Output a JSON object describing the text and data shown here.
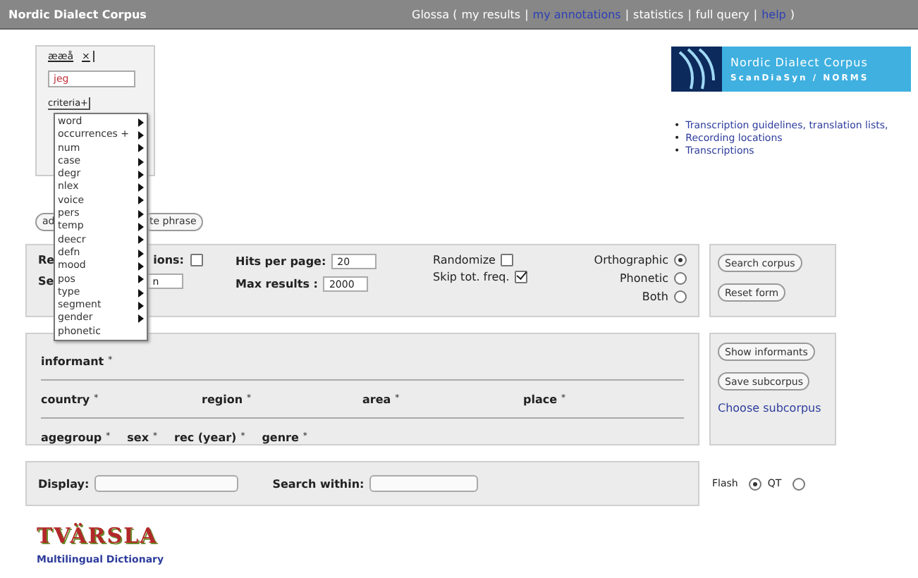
{
  "top_bar": {
    "title": "Nordic Dialect Corpus",
    "nav": [
      {
        "kind": "label",
        "text": "Glossa ("
      },
      {
        "kind": "link",
        "text": "my results",
        "highlighted": false
      },
      {
        "kind": "sep",
        "text": "|"
      },
      {
        "kind": "link",
        "text": "my annotations",
        "highlighted": true
      },
      {
        "kind": "sep",
        "text": "|"
      },
      {
        "kind": "link",
        "text": "statistics",
        "highlighted": false
      },
      {
        "kind": "sep",
        "text": "|"
      },
      {
        "kind": "link",
        "text": "full query",
        "highlighted": false
      },
      {
        "kind": "sep",
        "text": "|"
      },
      {
        "kind": "link",
        "text": "help",
        "highlighted": true
      },
      {
        "kind": "label",
        "text": ")"
      }
    ]
  },
  "token_box": {
    "header": "ææå",
    "close": "×",
    "value": "jeg",
    "criteria": "criteria+",
    "menu": [
      {
        "label": "word",
        "submenu": true
      },
      {
        "label": "occurrences +",
        "submenu": true
      },
      {
        "label": "num",
        "submenu": true
      },
      {
        "label": "case",
        "submenu": true
      },
      {
        "label": "degr",
        "submenu": true
      },
      {
        "label": "nlex",
        "submenu": true
      },
      {
        "label": "voice",
        "submenu": true
      },
      {
        "label": "pers",
        "submenu": true
      },
      {
        "label": "temp",
        "submenu": true
      },
      {
        "label": "deecr",
        "submenu": true
      },
      {
        "label": "defn",
        "submenu": true
      },
      {
        "label": "mood",
        "submenu": true
      },
      {
        "label": "pos",
        "submenu": true
      },
      {
        "label": "type",
        "submenu": true
      },
      {
        "label": "segment",
        "submenu": true
      },
      {
        "label": "gender",
        "submenu": true
      },
      {
        "label": "phonetic",
        "submenu": false
      }
    ]
  },
  "phrase_buttons": [
    "ad",
    "te phrase"
  ],
  "logo": {
    "title": "Nordic Dialect Corpus",
    "subtitle": "ScanDiaSyn / NORMS"
  },
  "links": [
    {
      "marker": "•",
      "text": "Transcription guidelines, translation lists,"
    },
    {
      "marker": "•",
      "text": "Recording locations"
    },
    {
      "marker": "•",
      "text": "Transcriptions"
    }
  ],
  "options": {
    "label_1_start": "Re",
    "label_1_end": "ions:",
    "checkbox_1": false,
    "label_2_start": "Se",
    "field_2": "n",
    "hits_label": "Hits per page:",
    "hits": "20",
    "max_label": "Max results :",
    "max": "2000",
    "checks": [
      {
        "label": "Randomize",
        "checked": false
      },
      {
        "label": "Skip tot. freq.",
        "checked": true
      }
    ],
    "scripts": [
      {
        "label": "Orthographic",
        "selected": true
      },
      {
        "label": "Phonetic",
        "selected": false
      },
      {
        "label": "Both",
        "selected": false
      }
    ]
  },
  "search_buttons": [
    "Search corpus",
    "Reset form"
  ],
  "informant_rows": [
    [
      "informant"
    ],
    [
      "country",
      "region",
      "area",
      "place"
    ],
    [
      "agegroup",
      "sex",
      "rec (year)",
      "genre"
    ]
  ],
  "star": "*",
  "informant_buttons": [
    "Show informants",
    "Save subcorpus"
  ],
  "choose_link": "Choose subcorpus",
  "display": {
    "label": "Display:",
    "within_label": "Search within:"
  },
  "player": [
    {
      "label": "Flash",
      "selected": true
    },
    {
      "label": "QT",
      "selected": false
    }
  ],
  "footer": {
    "logo": "TVÄRSLA",
    "caption": "Multilingual Dictionary"
  }
}
